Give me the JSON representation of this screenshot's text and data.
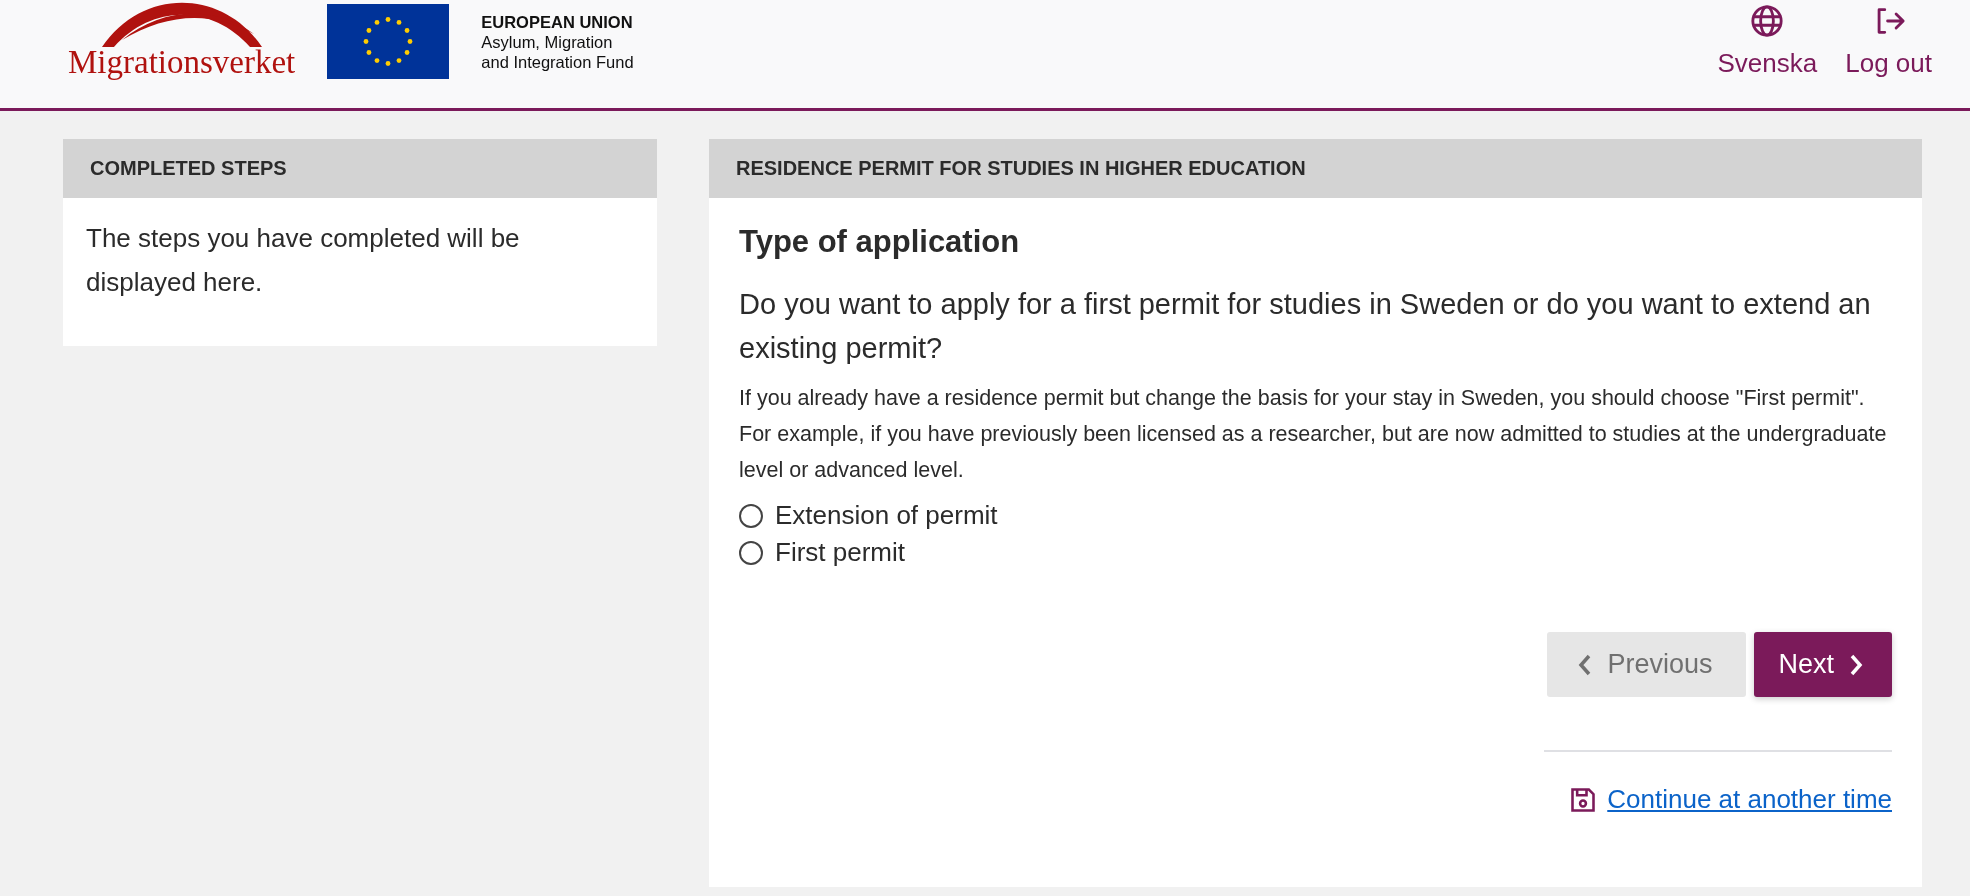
{
  "header": {
    "logo_text": "Migrationsverket",
    "eu": {
      "title": "EUROPEAN UNION",
      "line_1": "Asylum, Migration",
      "line_2": "and Integration Fund"
    },
    "actions": [
      {
        "kind": "language",
        "label": "Svenska"
      },
      {
        "kind": "logout",
        "label": "Log out"
      }
    ]
  },
  "sidebar": {
    "title": "COMPLETED STEPS",
    "text": "The steps you have completed will be displayed here."
  },
  "main": {
    "title": "RESIDENCE PERMIT FOR STUDIES IN HIGHER EDUCATION",
    "heading": "Type of application",
    "question": "Do you want to apply for a first permit for studies in Sweden or do you want to extend an existing permit?",
    "help": "If you already have a residence permit but change the basis for your stay in Sweden, you should choose \"First permit\". For example, if you have previously been licensed as a researcher, but are now admitted to studies at the undergraduate level or advanced level.",
    "options": [
      {
        "label": "Extension of permit",
        "selected": false
      },
      {
        "label": "First permit",
        "selected": false
      }
    ],
    "previous": {
      "label": "Previous",
      "disabled": true
    },
    "next": {
      "label": "Next",
      "disabled": false
    },
    "save_link": "Continue at another time"
  }
}
